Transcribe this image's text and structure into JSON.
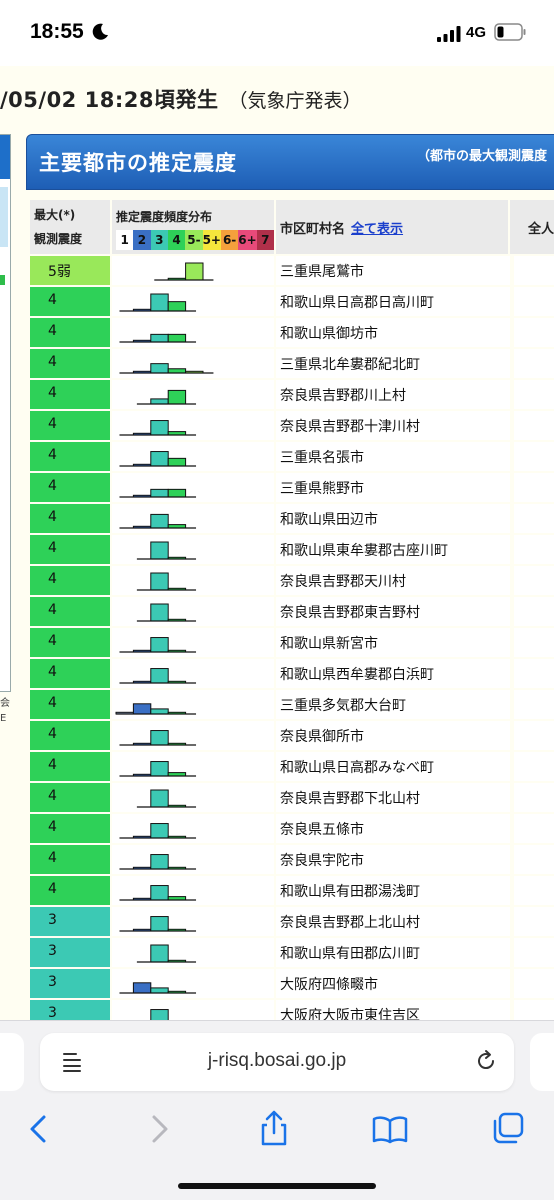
{
  "status": {
    "time": "18:55",
    "network": "4G"
  },
  "page": {
    "headline": "/05/02 18:28頃発生",
    "headline_source": "（気象庁発表）",
    "banner_title": "主要都市の推定震度",
    "banner_note": "（都市の最大観測震度",
    "left_note": [
      "会",
      "E"
    ],
    "table": {
      "col_intensity_l1": "最大(*)",
      "col_intensity_l2": "観測震度",
      "col_dist": "推定震度頻度分布",
      "scale": [
        "1",
        "2",
        "3",
        "4",
        "5-",
        "5+",
        "6-",
        "6+",
        "7"
      ],
      "col_city": "市区町村名",
      "col_city_link": "全て表示",
      "col_extra": "全人"
    },
    "colors": {
      "i5weak": "#99e85a",
      "i4": "#2ed158",
      "i3": "#3cc9b4",
      "i2": "#3a6fc4",
      "scale_bg": [
        "#ffffff",
        "#3a6fc4",
        "#3cc9b4",
        "#2ed158",
        "#99e85a",
        "#f5e63c",
        "#f5a03c",
        "#e84a7a",
        "#b0304a"
      ]
    }
  },
  "rows": [
    {
      "max": "5弱",
      "city": "三重県尾鷲市",
      "dist": [
        0,
        0,
        0,
        0.1,
        1.0,
        0,
        0,
        0,
        0
      ]
    },
    {
      "max": "4",
      "city": "和歌山県日高郡日高川町",
      "dist": [
        0,
        0.1,
        1.0,
        0.55,
        0,
        0,
        0,
        0,
        0
      ]
    },
    {
      "max": "4",
      "city": "和歌山県御坊市",
      "dist": [
        0,
        0.1,
        0.45,
        0.45,
        0,
        0,
        0,
        0,
        0
      ]
    },
    {
      "max": "4",
      "city": "三重県北牟婁郡紀北町",
      "dist": [
        0,
        0.1,
        0.55,
        0.25,
        0.1,
        0,
        0,
        0,
        0
      ]
    },
    {
      "max": "4",
      "city": "奈良県吉野郡川上村",
      "dist": [
        0,
        0,
        0.3,
        0.8,
        0,
        0,
        0,
        0,
        0
      ]
    },
    {
      "max": "4",
      "city": "奈良県吉野郡十津川村",
      "dist": [
        0,
        0.1,
        0.85,
        0.2,
        0,
        0,
        0,
        0,
        0
      ]
    },
    {
      "max": "4",
      "city": "三重県名張市",
      "dist": [
        0,
        0.1,
        0.85,
        0.45,
        0,
        0,
        0,
        0,
        0
      ]
    },
    {
      "max": "4",
      "city": "三重県熊野市",
      "dist": [
        0,
        0.1,
        0.45,
        0.45,
        0,
        0,
        0,
        0,
        0
      ]
    },
    {
      "max": "4",
      "city": "和歌山県田辺市",
      "dist": [
        0,
        0.1,
        0.8,
        0.2,
        0,
        0,
        0,
        0,
        0
      ]
    },
    {
      "max": "4",
      "city": "和歌山県東牟婁郡古座川町",
      "dist": [
        0,
        0,
        1.0,
        0.1,
        0,
        0,
        0,
        0,
        0
      ]
    },
    {
      "max": "4",
      "city": "奈良県吉野郡天川村",
      "dist": [
        0,
        0,
        1.0,
        0.1,
        0,
        0,
        0,
        0,
        0
      ]
    },
    {
      "max": "4",
      "city": "奈良県吉野郡東吉野村",
      "dist": [
        0,
        0,
        1.0,
        0.1,
        0,
        0,
        0,
        0,
        0
      ]
    },
    {
      "max": "4",
      "city": "和歌山県新宮市",
      "dist": [
        0,
        0.1,
        0.85,
        0.1,
        0,
        0,
        0,
        0,
        0
      ]
    },
    {
      "max": "4",
      "city": "和歌山県西牟婁郡白浜町",
      "dist": [
        0,
        0.1,
        0.85,
        0.1,
        0,
        0,
        0,
        0,
        0
      ]
    },
    {
      "max": "4",
      "city": "三重県多気郡大台町",
      "dist": [
        0.1,
        0.6,
        0.3,
        0.1,
        0,
        0,
        0,
        0,
        0
      ]
    },
    {
      "max": "4",
      "city": "奈良県御所市",
      "dist": [
        0,
        0.1,
        0.85,
        0.1,
        0,
        0,
        0,
        0,
        0
      ]
    },
    {
      "max": "4",
      "city": "和歌山県日高郡みなべ町",
      "dist": [
        0,
        0.1,
        0.85,
        0.2,
        0,
        0,
        0,
        0,
        0
      ]
    },
    {
      "max": "4",
      "city": "奈良県吉野郡下北山村",
      "dist": [
        0,
        0,
        1.0,
        0.1,
        0,
        0,
        0,
        0,
        0
      ]
    },
    {
      "max": "4",
      "city": "奈良県五條市",
      "dist": [
        0,
        0.1,
        0.85,
        0.1,
        0,
        0,
        0,
        0,
        0
      ]
    },
    {
      "max": "4",
      "city": "奈良県宇陀市",
      "dist": [
        0,
        0.1,
        0.85,
        0.1,
        0,
        0,
        0,
        0,
        0
      ]
    },
    {
      "max": "4",
      "city": "和歌山県有田郡湯浅町",
      "dist": [
        0,
        0.1,
        0.85,
        0.2,
        0,
        0,
        0,
        0,
        0
      ]
    },
    {
      "max": "3",
      "city": "奈良県吉野郡上北山村",
      "dist": [
        0,
        0.1,
        0.85,
        0.1,
        0,
        0,
        0,
        0,
        0
      ]
    },
    {
      "max": "3",
      "city": "和歌山県有田郡広川町",
      "dist": [
        0,
        0,
        1.0,
        0.1,
        0,
        0,
        0,
        0,
        0
      ]
    },
    {
      "max": "3",
      "city": "大阪府四條畷市",
      "dist": [
        0,
        0.6,
        0.3,
        0.1,
        0,
        0,
        0,
        0,
        0
      ]
    },
    {
      "max": "3",
      "city": "大阪府大阪市東住吉区",
      "dist": [
        0,
        0.1,
        0.85,
        0.1,
        0,
        0,
        0,
        0,
        0
      ]
    }
  ],
  "browser": {
    "url": "j-risq.bosai.go.jp",
    "icons": [
      "reader-icon",
      "reload-icon",
      "back-icon",
      "forward-icon",
      "share-icon",
      "bookmarks-icon",
      "tabs-icon"
    ]
  }
}
